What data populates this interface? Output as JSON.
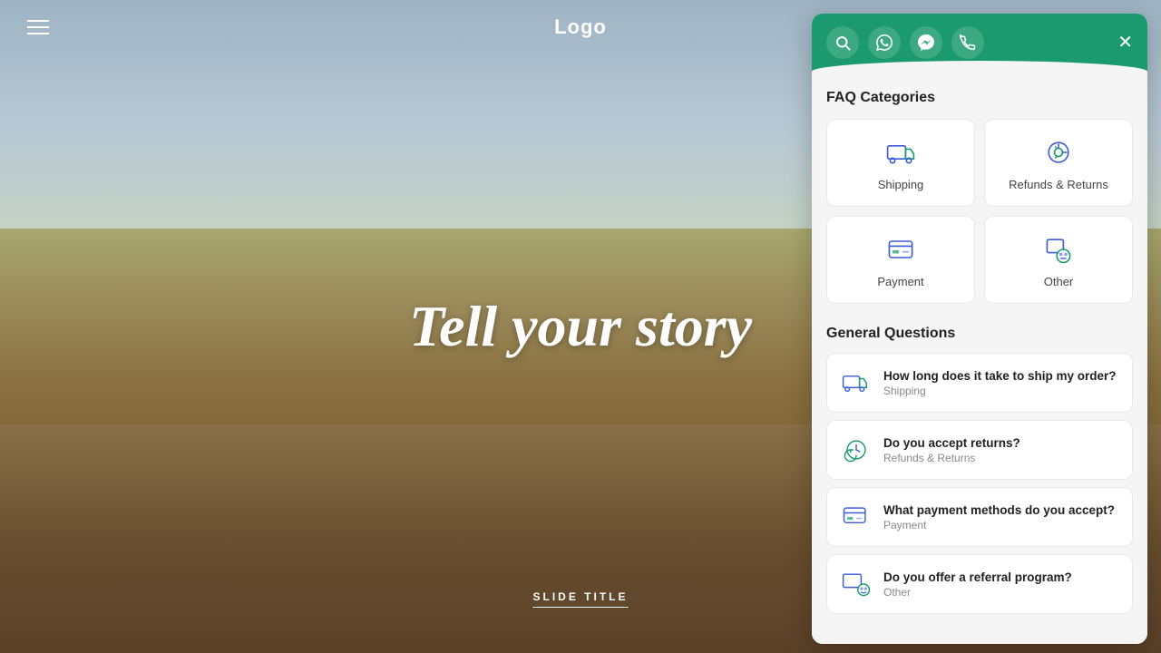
{
  "site": {
    "logo": "Logo",
    "menu_icon": "≡",
    "hero_title": "Tell your story",
    "slide_title": "SLIDE TITLE"
  },
  "panel": {
    "header": {
      "close_label": "×",
      "icons": [
        {
          "id": "search",
          "symbol": "🔍",
          "name": "search-icon"
        },
        {
          "id": "whatsapp",
          "symbol": "💬",
          "name": "whatsapp-icon"
        },
        {
          "id": "messenger",
          "symbol": "💬",
          "name": "messenger-icon"
        },
        {
          "id": "phone",
          "symbol": "📞",
          "name": "phone-icon"
        }
      ]
    },
    "faq_categories_title": "FAQ Categories",
    "categories": [
      {
        "id": "shipping",
        "label": "Shipping"
      },
      {
        "id": "refunds",
        "label": "Refunds & Returns"
      },
      {
        "id": "payment",
        "label": "Payment"
      },
      {
        "id": "other",
        "label": "Other"
      }
    ],
    "general_questions_title": "General Questions",
    "questions": [
      {
        "id": "q1",
        "text": "How long does it take to ship my order?",
        "category": "Shipping"
      },
      {
        "id": "q2",
        "text": "Do you accept returns?",
        "category": "Refunds & Returns"
      },
      {
        "id": "q3",
        "text": "What payment methods do you accept?",
        "category": "Payment"
      },
      {
        "id": "q4",
        "text": "Do you offer a referral program?",
        "category": "Other"
      }
    ]
  },
  "colors": {
    "header_green": "#1a9a6e",
    "icon_blue": "#3b5bdb",
    "icon_teal": "#1a9a6e"
  }
}
